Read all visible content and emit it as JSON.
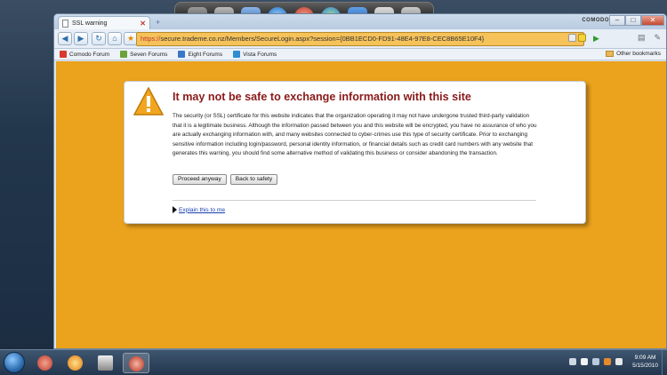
{
  "browser": {
    "tab_title": "SSL warning",
    "tab_close": "✕",
    "new_tab": "+",
    "brand": "COMODO",
    "controls": {
      "minimize": "–",
      "maximize": "□",
      "close": "✕"
    },
    "url_protocol": "https://",
    "url_rest": "secure.trademe.co.nz/Members/SecureLogin.aspx?session={0BB1ECD0-FD91-48E4-97E8-CEC8B65E10F4}",
    "nav": {
      "back": "◀",
      "forward": "▶",
      "reload": "↻",
      "home": "⌂",
      "star": "★"
    },
    "bookmarks": [
      {
        "label": "Comodo Forum",
        "color": "#d83a2e"
      },
      {
        "label": "Seven Forums",
        "color": "#6aa23a"
      },
      {
        "label": "Eight Forums",
        "color": "#3a77c8"
      },
      {
        "label": "Vista Forums",
        "color": "#2f8dd2"
      }
    ],
    "other_bookmarks": "Other bookmarks"
  },
  "warning": {
    "headline": "It may not be safe to exchange information with this site",
    "body": "The security (or SSL) certificate for this website indicates that the organization operating it may not have undergone trusted third-party validation that it is a legitimate business. Although the information passed between you and this website will be encrypted, you have no assurance of who you are actually exchanging information with, and many websites connected to cyber-crimes use this type of security certificate. Prior to exchanging sensitive information including login/password, personal identity information, or financial details such as credit card numbers with any website that generates this warning, you should find some alternative method of validating this business or consider abandoning the transaction.",
    "proceed_label": "Proceed anyway",
    "back_label": "Back to safety",
    "explain_label": "Explain this to me"
  },
  "taskbar": {
    "time": "9:09 AM",
    "date": "5/15/2010"
  },
  "colors": {
    "page_background": "#eba21c",
    "headline": "#8b1a1a",
    "omnibox": "#f6c25a"
  }
}
